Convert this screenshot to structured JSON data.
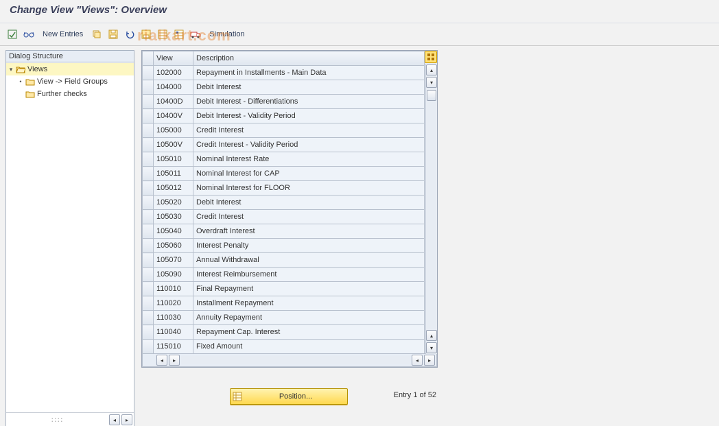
{
  "title": "Change View \"Views\": Overview",
  "toolbar": {
    "new_entries": "New Entries",
    "simulation": "Simulation"
  },
  "tree": {
    "header": "Dialog Structure",
    "root": "Views",
    "child1": "View -> Field Groups",
    "child2": "Further checks"
  },
  "table": {
    "col_view": "View",
    "col_desc": "Description",
    "rows": [
      {
        "view": "102000",
        "desc": "Repayment in Installments - Main Data"
      },
      {
        "view": "104000",
        "desc": "Debit Interest"
      },
      {
        "view": "10400D",
        "desc": "Debit Interest - Differentiations"
      },
      {
        "view": "10400V",
        "desc": "Debit Interest - Validity Period"
      },
      {
        "view": "105000",
        "desc": "Credit Interest"
      },
      {
        "view": "10500V",
        "desc": "Credit Interest - Validity Period"
      },
      {
        "view": "105010",
        "desc": "Nominal Interest Rate"
      },
      {
        "view": "105011",
        "desc": "Nominal Interest for CAP"
      },
      {
        "view": "105012",
        "desc": "Nominal Interest for FLOOR"
      },
      {
        "view": "105020",
        "desc": "Debit Interest"
      },
      {
        "view": "105030",
        "desc": "Credit Interest"
      },
      {
        "view": "105040",
        "desc": "Overdraft Interest"
      },
      {
        "view": "105060",
        "desc": "Interest Penalty"
      },
      {
        "view": "105070",
        "desc": "Annual Withdrawal"
      },
      {
        "view": "105090",
        "desc": "Interest Reimbursement"
      },
      {
        "view": "110010",
        "desc": "Final Repayment"
      },
      {
        "view": "110020",
        "desc": "Installment Repayment"
      },
      {
        "view": "110030",
        "desc": "Annuity Repayment"
      },
      {
        "view": "110040",
        "desc": "Repayment Cap. Interest"
      },
      {
        "view": "115010",
        "desc": "Fixed Amount"
      }
    ]
  },
  "footer": {
    "position_label": "Position...",
    "entry_label": "Entry 1 of 52"
  },
  "watermark": "rialkart.com"
}
